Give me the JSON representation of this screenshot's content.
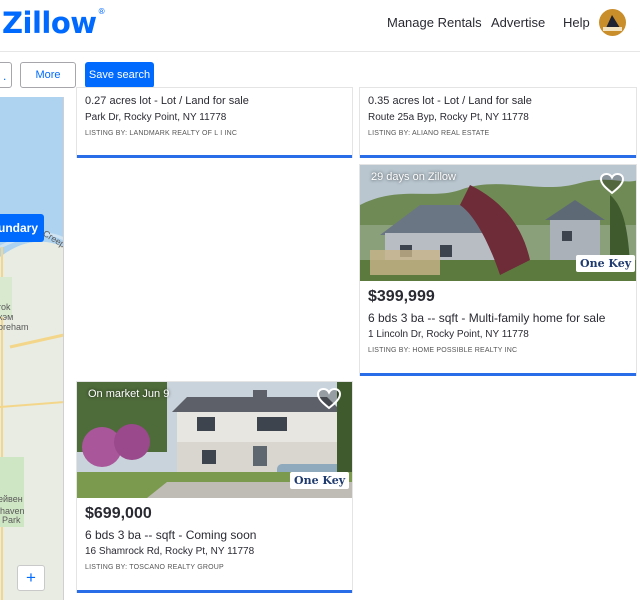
{
  "header": {
    "logo": "Zillow",
    "logo_mark": "®",
    "nav": [
      "Manage Rentals",
      "Advertise",
      "Help"
    ]
  },
  "filters": {
    "stub_label": ".",
    "more_label": "More",
    "save_search_label": "Save search"
  },
  "map": {
    "boundary_label": "undary",
    "labels": [
      "Сгеер",
      "rok",
      "xэм",
      "oreham",
      "ейвен",
      "haven",
      "Park"
    ],
    "zoom_in": "+"
  },
  "listings": [
    {
      "type_line": "0.27 acres lot  - Lot / Land for sale",
      "address": "Park Dr, Rocky Point, NY 11778",
      "listed_by": "LISTING BY: LANDMARK REALTY OF L I INC"
    },
    {
      "type_line": "0.35 acres lot  - Lot / Land for sale",
      "address": "Route 25a Byp, Rocky Pt, NY 11778",
      "listed_by": "LISTING BY: ALIANO REAL ESTATE"
    },
    {
      "tag": "29 days on Zillow",
      "price": "$399,999",
      "facts": "6 bds  3 ba  -- sqft  - Multi-family home for sale",
      "address": "1 Lincoln Dr, Rocky Point, NY 11778",
      "listed_by": "LISTING BY: HOME POSSIBLE REALTY INC",
      "badge": "One Key"
    },
    {
      "tag": "On market Jun 9",
      "price": "$699,000",
      "facts": "6 bds  3 ba  -- sqft  - Coming soon",
      "address": "16 Shamrock Rd, Rocky Pt, NY 11778",
      "listed_by": "LISTING BY: TOSCANO REALTY GROUP",
      "badge": "One Key"
    }
  ],
  "colors": {
    "brand": "#006aff",
    "card_bar": "#2a6de8"
  }
}
